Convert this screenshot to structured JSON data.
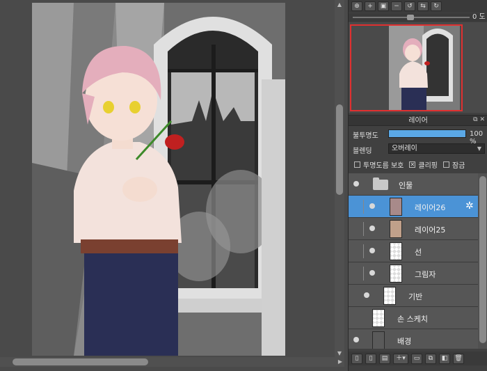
{
  "navigator": {
    "angle_label": "0 도",
    "buttons": [
      "zoom-fit",
      "zoom-in",
      "fit-window",
      "zoom-out",
      "rotate-left",
      "flip",
      "rotate-right"
    ]
  },
  "layer_panel": {
    "title": "레이어",
    "opacity_label": "불투명도",
    "opacity_value": "100 %",
    "opacity_fraction": 1.0,
    "blend_label": "블렌딩",
    "blend_mode": "오버레이",
    "check_protect_label": "투명도름 보호",
    "check_clipping_label": "클리핑",
    "check_lock_label": "잠금",
    "clipping_checked": true
  },
  "layers": [
    {
      "name": "인물",
      "type": "folder",
      "selected": false
    },
    {
      "name": "레이어26",
      "type": "layer",
      "selected": true
    },
    {
      "name": "레이어25",
      "type": "layer",
      "selected": false
    },
    {
      "name": "선",
      "type": "layer",
      "selected": false
    },
    {
      "name": "그림자",
      "type": "layer",
      "selected": false
    },
    {
      "name": "기반",
      "type": "layer",
      "selected": false
    },
    {
      "name": "손 스케치",
      "type": "layer",
      "selected": false
    },
    {
      "name": "배경",
      "type": "layer",
      "selected": false
    }
  ],
  "colors": {
    "accent": "#4b93d6",
    "opacity_fill": "#5ba8e6",
    "navigator_frame": "#e03030"
  }
}
